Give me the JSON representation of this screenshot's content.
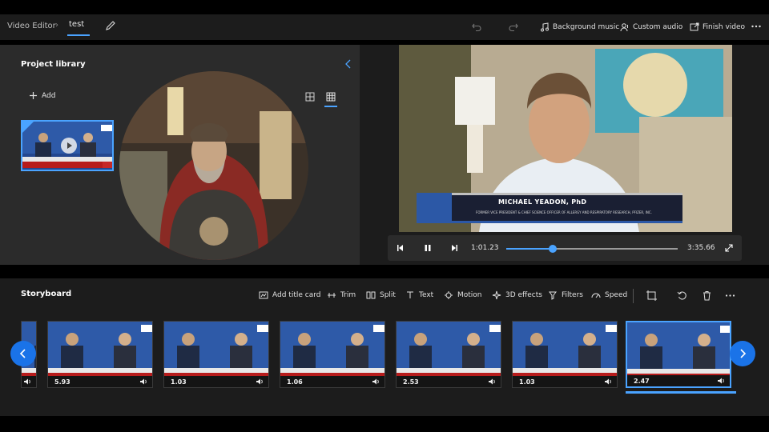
{
  "header": {
    "app_name": "Video Editor",
    "project_name": "test",
    "background_music_label": "Background music",
    "custom_audio_label": "Custom audio",
    "finish_video_label": "Finish video"
  },
  "library": {
    "title": "Project library",
    "add_label": "Add"
  },
  "preview": {
    "lower_third_name": "MICHAEL YEADON, PhD",
    "lower_third_sub": "FORMER VICE PRESIDENT & CHIEF SCIENCE OFFICER OF ALLERGY AND RESPIRATORY RESEARCH, PFIZER, INC.",
    "current_time": "1:01.23",
    "total_time": "3:35.66",
    "progress": 0.27
  },
  "storyboard": {
    "title": "Storyboard",
    "tools": {
      "add_title_card": "Add title card",
      "trim": "Trim",
      "split": "Split",
      "text": "Text",
      "motion": "Motion",
      "effects_3d": "3D effects",
      "filters": "Filters",
      "speed": "Speed"
    },
    "clips": [
      {
        "duration": "",
        "selected": false
      },
      {
        "duration": "5.93",
        "selected": false
      },
      {
        "duration": "1.03",
        "selected": false
      },
      {
        "duration": "1.06",
        "selected": false
      },
      {
        "duration": "2.53",
        "selected": false
      },
      {
        "duration": "1.03",
        "selected": false
      },
      {
        "duration": "2.47",
        "selected": true
      }
    ]
  },
  "colors": {
    "accent": "#4aa3ff",
    "nav_button": "#1a73e8",
    "panel": "#2b2b2b",
    "toolbar": "#1c1c1c"
  }
}
